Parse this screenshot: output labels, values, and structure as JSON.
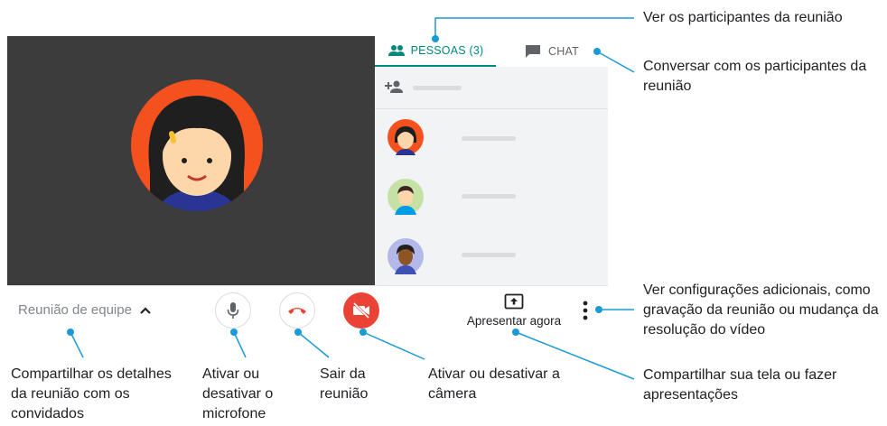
{
  "panel": {
    "tab_people": "PESSOAS (3)",
    "tab_chat": "CHAT",
    "people_icon": "people-icon",
    "chat_icon": "chat-icon",
    "add_person_icon": "add-person-icon"
  },
  "controls": {
    "meeting_name": "Reunião de equipe",
    "present_label": "Apresentar agora"
  },
  "annotations": {
    "participants": "Ver os participantes da reunião",
    "chat": "Conversar com os participantes da reunião",
    "settings": "Ver configurações adicionais, como gravação da reunião ou mudança da resolução do vídeo",
    "details": "Compartilhar os detalhes da reunião com os convidados",
    "mic": "Ativar ou desativar o microfone",
    "leave": "Sair da reunião",
    "camera": "Ativar ou desativar a câmera",
    "present": "Compartilhar sua tela ou fazer apresentações"
  },
  "colors": {
    "accent": "#00897b",
    "red": "#ea4335",
    "callout": "#1a9ad6",
    "avatar_orange": "#f4511e"
  }
}
